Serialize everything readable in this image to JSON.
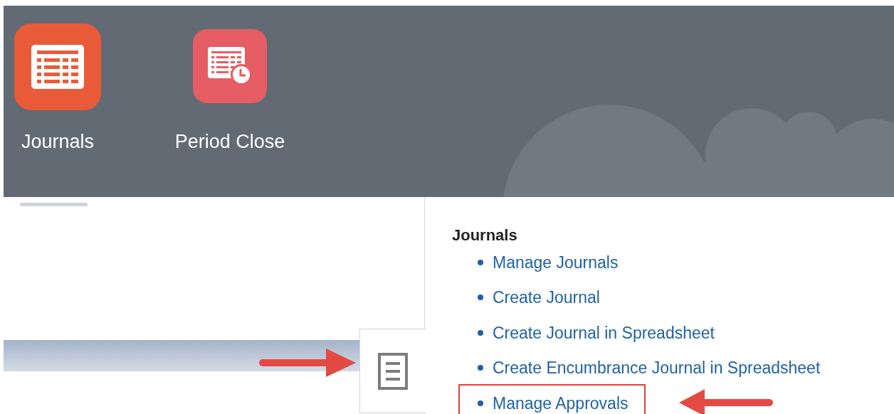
{
  "tiles": [
    {
      "label": "Journals",
      "kind": "table",
      "color": "#e95b38"
    },
    {
      "label": "Period Close",
      "kind": "table-clock",
      "color": "#e65d63"
    }
  ],
  "task_panel": {
    "heading": "Journals",
    "links": [
      {
        "label": "Manage Journals",
        "highlighted": false
      },
      {
        "label": "Create Journal",
        "highlighted": false
      },
      {
        "label": "Create Journal in Spreadsheet",
        "highlighted": false
      },
      {
        "label": "Create Encumbrance Journal in Spreadsheet",
        "highlighted": false
      },
      {
        "label": "Manage Approvals",
        "highlighted": true
      }
    ]
  }
}
